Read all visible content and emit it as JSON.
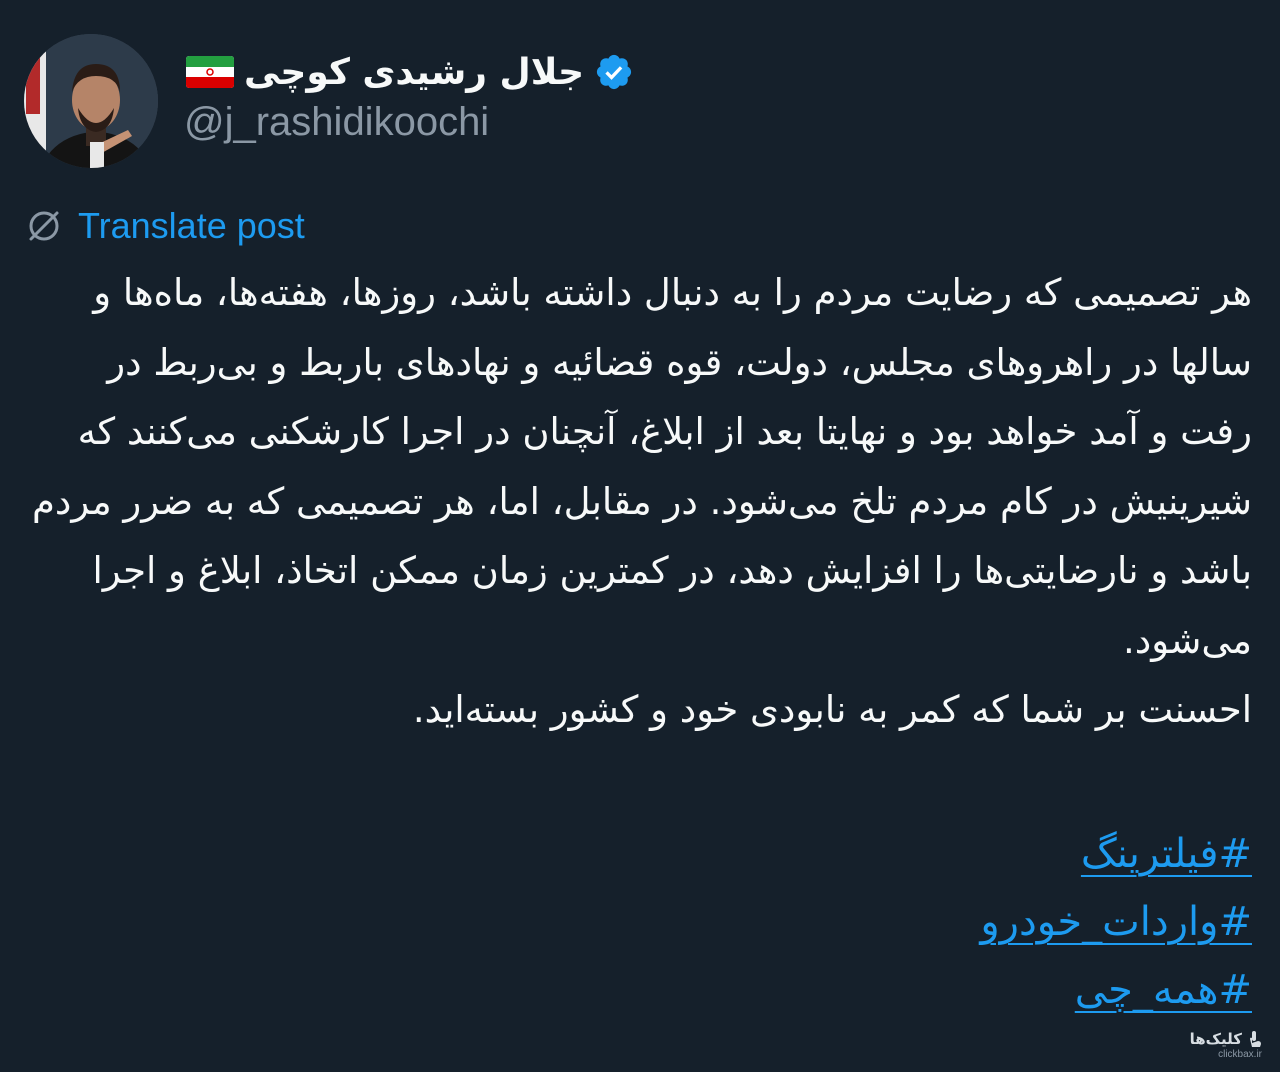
{
  "author": {
    "display_name": "جلال رشیدی کوچی",
    "handle": "@j_rashidikoochi",
    "verified": true,
    "flag_icon": "iran-flag-icon",
    "avatar": "profile-photo"
  },
  "translate": {
    "icon": "globe-slash-icon",
    "label": "Translate post"
  },
  "post": {
    "paragraph_1": "هر تصمیمی که رضایت مردم را به دنبال داشته باشد، روزها، هفته‌ها، ماه‌ها و سالها در راهروهای مجلس، دولت، قوه قضائیه و نهادهای باربط و بی‌ربط در رفت و آمد خواهد بود و نهایتا بعد از ابلاغ، آنچنان در اجرا کارشکنی می‌کنند که شیرینیش در کام مردم تلخ می‌شود. در مقابل، اما، هر تصمیمی که به ضرر مردم باشد و نارضایتی‌ها را افزایش دهد، در کمترین زمان ممکن اتخاذ، ابلاغ و اجرا می‌شود.",
    "paragraph_2": "احسنت بر شما که کمر به نابودی خود و کشور بسته‌اید.",
    "hashtags": [
      "#فیلترینگ",
      "#واردات_خودرو",
      "#همه_چی"
    ]
  },
  "watermark": {
    "name": "کلیک‌ها",
    "url": "clickbax.ir",
    "icon": "pointer-hand-icon"
  },
  "colors": {
    "background": "#15202b",
    "text": "#f7f9f9",
    "muted": "#8b98a5",
    "accent": "#1d9bf0"
  }
}
